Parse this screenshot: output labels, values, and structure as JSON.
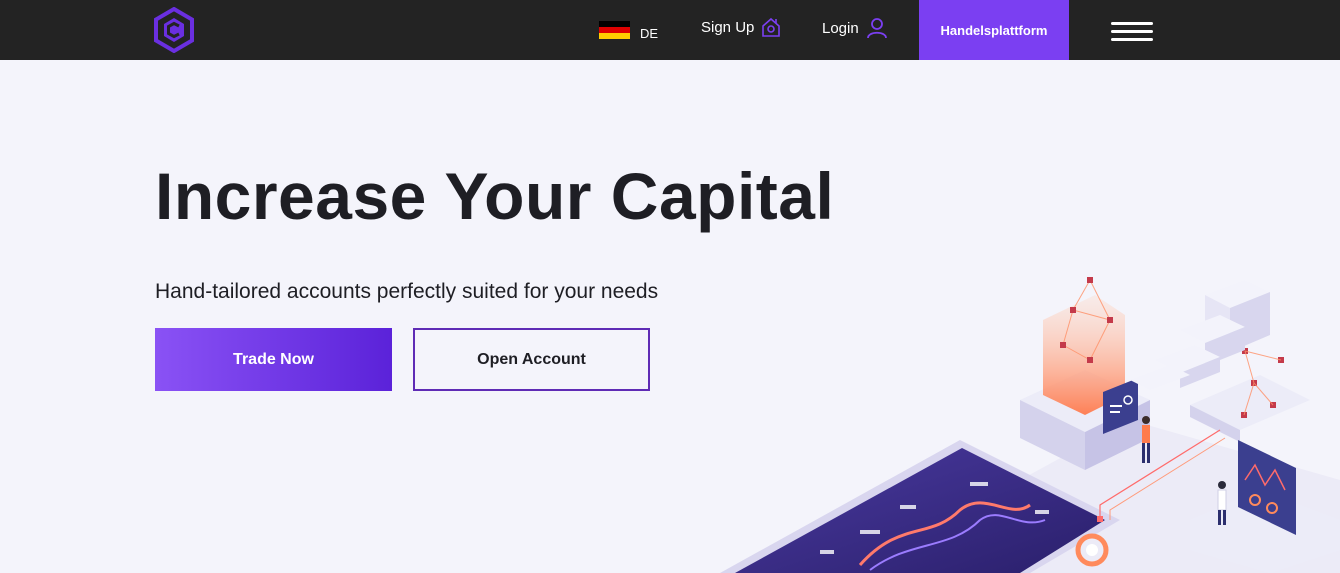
{
  "header": {
    "language": {
      "code": "DE",
      "flag_colors": [
        "#000000",
        "#dd0000",
        "#ffce00"
      ]
    },
    "signup_label": "Sign Up",
    "login_label": "Login",
    "platform_label": "Handelsplattform",
    "icons": [
      "logo-icon",
      "home-icon",
      "user-icon",
      "menu-icon"
    ]
  },
  "hero": {
    "title": "Increase Your Capital",
    "subtitle": "Hand-tailored accounts perfectly suited for your needs",
    "primary_button": "Trade Now",
    "secondary_button": "Open Account"
  },
  "colors": {
    "accent": "#7b3ff2",
    "header_bg": "#232323",
    "page_bg": "#f4f4fb",
    "text": "#1e1e24"
  }
}
